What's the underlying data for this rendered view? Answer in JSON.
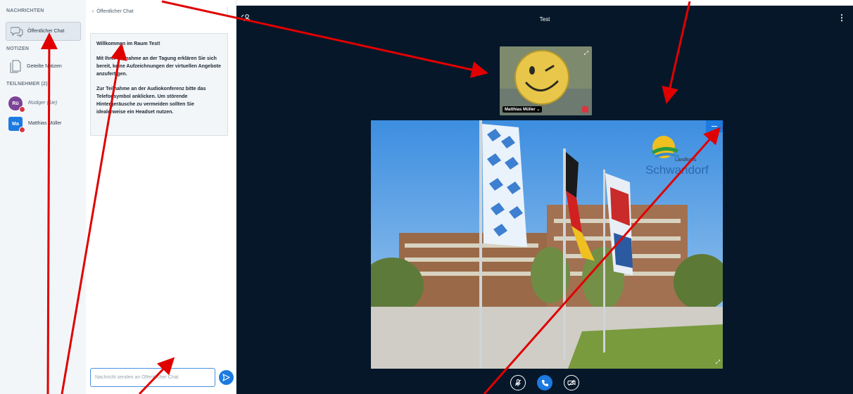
{
  "sidebar": {
    "messages_title": "NACHRICHTEN",
    "public_chat_label": "Öffentlicher Chat",
    "notes_title": "NOTIZEN",
    "shared_notes_label": "Geteilte Notizen",
    "participants_title": "TEILNEHMER (2)",
    "users": [
      {
        "initials": "Rü",
        "name": "Rüdiger",
        "suffix": "(Sie)",
        "color": "#7b4397"
      },
      {
        "initials": "Ma",
        "name": "Matthias Müller",
        "suffix": "",
        "color": "#1c7ae0"
      }
    ]
  },
  "chat": {
    "header": "Öffentlicher Chat",
    "welcome_title": "Willkommen im Raum Test!",
    "welcome_p1": "Mit Ihrer Teilnahme an der Tagung erklären Sie sich bereit, keine Aufzeichnungen der virtuellen Angebote anzufertigen.",
    "welcome_p2": "Zur Teilnahme an der Audiokonferenz bitte das Telefonsymbol anklicken. Um störende Hintergeräusche zu vermeiden sollten Sie idealerweise ein Headset nutzen.",
    "input_placeholder": "Nachricht senden an Öffentlicher Chat"
  },
  "main": {
    "title": "Test",
    "webcam_name": "Matthias Müller",
    "logo_small": "Landkreis",
    "logo_big": "Schwandorf"
  },
  "colors": {
    "accent": "#1c7ae0",
    "main_bg": "#06172a",
    "mute": "#d9363e",
    "arrow": "#e00000"
  }
}
